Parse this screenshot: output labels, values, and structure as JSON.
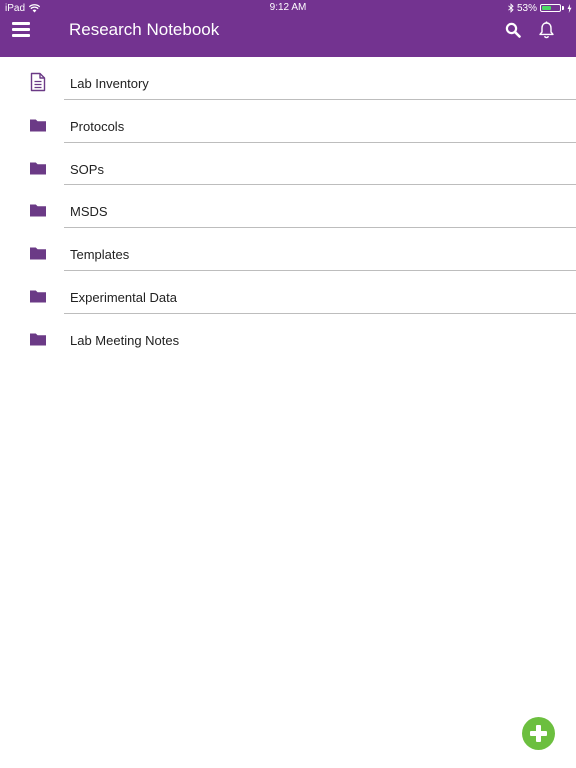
{
  "status_bar": {
    "device": "iPad",
    "time": "9:12 AM",
    "battery_percent": "53%",
    "battery_level": 0.53,
    "icons": [
      "wifi-icon",
      "bluetooth-icon",
      "battery-icon",
      "charging-icon"
    ]
  },
  "header": {
    "title": "Research Notebook",
    "background_color": "#733390",
    "icons": [
      "menu-icon",
      "search-icon",
      "bell-icon"
    ]
  },
  "items": [
    {
      "label": "Lab Inventory",
      "icon": "document-icon"
    },
    {
      "label": "Protocols",
      "icon": "folder-icon"
    },
    {
      "label": "SOPs",
      "icon": "folder-icon"
    },
    {
      "label": "MSDS",
      "icon": "folder-icon"
    },
    {
      "label": "Templates",
      "icon": "folder-icon"
    },
    {
      "label": "Experimental Data",
      "icon": "folder-icon"
    },
    {
      "label": "Lab Meeting Notes",
      "icon": "folder-icon"
    }
  ],
  "fab": {
    "icon": "plus-icon",
    "color": "#6cbf3f"
  },
  "colors": {
    "accent": "#733390",
    "folder": "#6b3a86",
    "divider": "#bdbdbd"
  }
}
